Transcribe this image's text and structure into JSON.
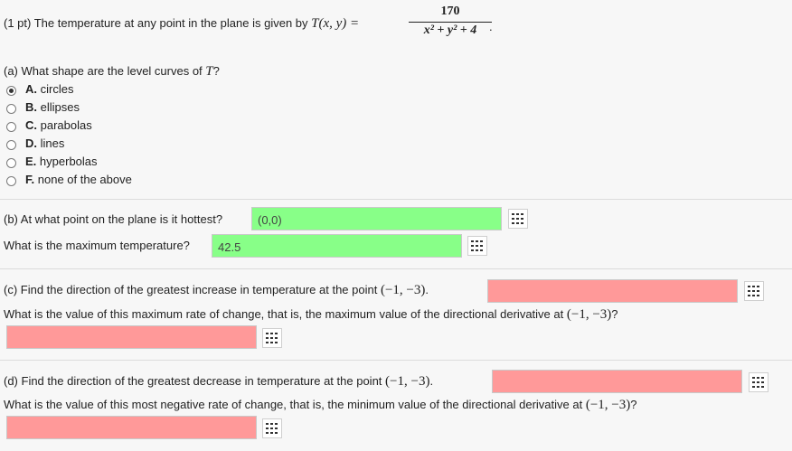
{
  "header": {
    "points": "(1 pt) The temperature at any point in the plane is given by",
    "func_lhs": "T(x, y) =",
    "numerator": "170",
    "denominator": "x² + y² + 4",
    "period": "."
  },
  "part_a": {
    "question_prefix": "(a) What shape are the level curves of",
    "question_var": "T",
    "question_suffix": "?",
    "options": [
      {
        "letter": "A.",
        "label": "circles",
        "checked": true
      },
      {
        "letter": "B.",
        "label": "ellipses",
        "checked": false
      },
      {
        "letter": "C.",
        "label": "parabolas",
        "checked": false
      },
      {
        "letter": "D.",
        "label": "lines",
        "checked": false
      },
      {
        "letter": "E.",
        "label": "hyperbolas",
        "checked": false
      },
      {
        "letter": "F.",
        "label": "none of the above",
        "checked": false
      }
    ]
  },
  "part_b": {
    "q1": "(b) At what point on the plane is it hottest?",
    "a1": "(0,0)",
    "q2": "What is the maximum temperature?",
    "a2": "42.5"
  },
  "part_c": {
    "q1_prefix": "(c) Find the direction of the greatest increase in temperature at the point",
    "point": "(−1, −3)",
    "q1_suffix": ".",
    "q2_prefix": "What is the value of this maximum rate of change, that is, the maximum value of the directional derivative at",
    "q2_suffix": "?",
    "a1": "",
    "a2": ""
  },
  "part_d": {
    "q1_prefix": "(d) Find the direction of the greatest decrease in temperature at the point",
    "point": "(−1, −3)",
    "q1_suffix": ".",
    "q2_prefix": "What is the value of this most negative rate of change, that is, the minimum value of the directional derivative at",
    "q2_suffix": "?",
    "a1": "",
    "a2": ""
  },
  "icons": {
    "entry_tool": "matrix-grid-icon"
  },
  "colors": {
    "correct": "#88ff88",
    "incorrect": "#ff9999"
  }
}
